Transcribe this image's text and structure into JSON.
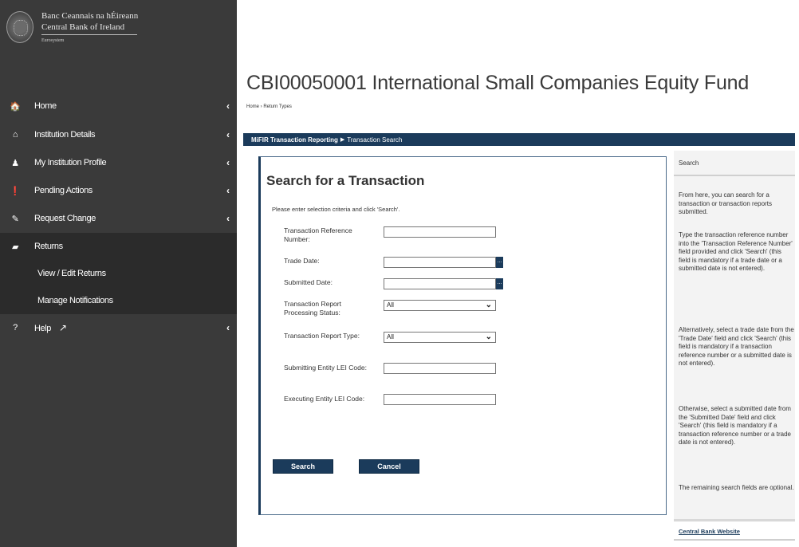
{
  "logo": {
    "line1": "Banc Ceannais na hÉireann",
    "line2": "Central Bank of Ireland",
    "line3": "Eurosystem"
  },
  "sidebar": {
    "items": [
      {
        "label": "Home",
        "icon": "home-icon",
        "glyph": "🏠"
      },
      {
        "label": "Institution Details",
        "icon": "bank-icon",
        "glyph": "⌂"
      },
      {
        "label": "My Institution Profile",
        "icon": "user-icon",
        "glyph": "♟"
      },
      {
        "label": "Pending Actions",
        "icon": "exclamation-circle-icon",
        "glyph": "❗"
      },
      {
        "label": "Request Change",
        "icon": "edit-icon",
        "glyph": "✎"
      },
      {
        "label": "Returns",
        "icon": "folder-open-icon",
        "glyph": "▰"
      },
      {
        "label": "Help",
        "icon": "question-circle-icon",
        "glyph": "?"
      }
    ],
    "sub_items": [
      "View / Edit Returns",
      "Manage Notifications"
    ],
    "chevron": "‹",
    "external_glyph": "↗"
  },
  "page": {
    "title": "CBI00050001 International Small Companies Equity Fund",
    "breadcrumb": "Home › Return Types"
  },
  "crumbbar": {
    "part1": "MiFIR Transaction Reporting",
    "arrow": "▶",
    "part2": "Transaction Search"
  },
  "form": {
    "title": "Search for a Transaction",
    "intro": "Please enter selection criteria and click 'Search'.",
    "fields": {
      "trn_label": "Transaction Reference Number:",
      "trade_date_label": "Trade Date:",
      "submitted_date_label": "Submitted Date:",
      "status_label": "Transaction Report Processing Status:",
      "status_value": "All",
      "type_label": "Transaction Report Type:",
      "type_value": "All",
      "submitting_lei_label": "Submitting Entity LEI Code:",
      "executing_lei_label": "Executing Entity LEI Code:"
    },
    "trn_value": "",
    "trade_date_value": "",
    "submitted_date_value": "",
    "submitting_lei_value": "",
    "executing_lei_value": "",
    "date_button": "...",
    "caret": "⌄",
    "search_button": "Search",
    "cancel_button": "Cancel"
  },
  "help": {
    "title": "Search",
    "p1": "From here, you can search for a transaction or transaction reports submitted.",
    "p2": "Type the transaction reference number into the 'Transaction Reference Number' field provided and click 'Search' (this field is mandatory if a trade date or a submitted date is not entered).",
    "p3": "Alternatively, select a trade date from the 'Trade Date' field and click 'Search' (this field is mandatory if a transaction reference number or a submitted date is not entered).",
    "p4": "Otherwise, select a submitted date from the 'Submitted Date' field and click 'Search' (this field is mandatory if a transaction reference number or a trade date is not entered).",
    "p5": "The remaining search fields are optional.",
    "link": "Central Bank Website"
  },
  "colors": {
    "sidebar_bg": "#3a3a3a",
    "sidebar_active_bg": "#2b2b2b",
    "accent_navy": "#1b3b5b",
    "help_bg": "#f3f3f3"
  }
}
